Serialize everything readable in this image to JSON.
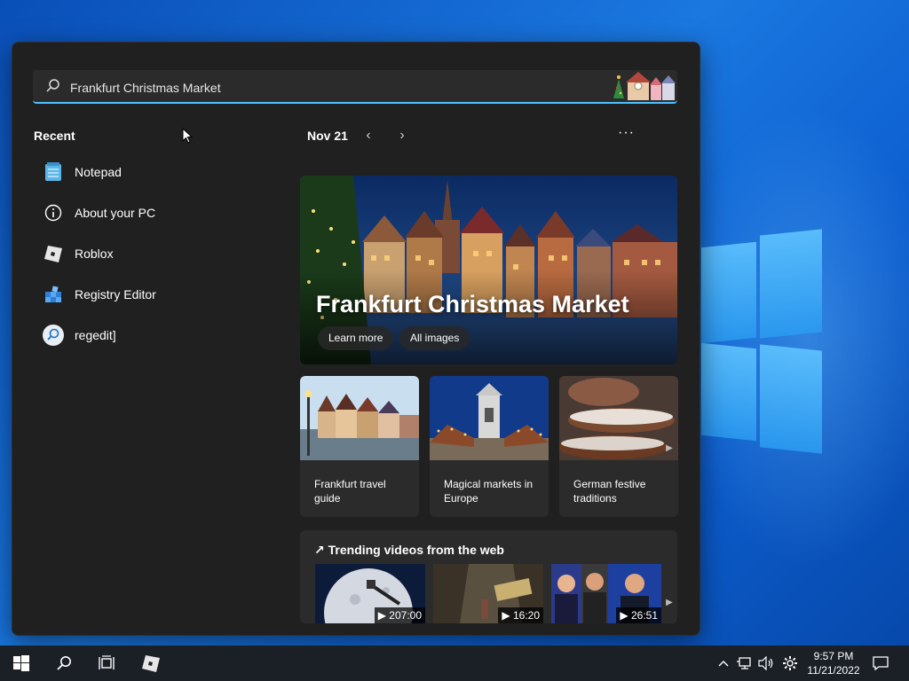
{
  "search": {
    "value": "Frankfurt Christmas Market",
    "placeholder": ""
  },
  "recent": {
    "title": "Recent",
    "items": [
      {
        "label": "Notepad",
        "icon": "notepad-icon"
      },
      {
        "label": "About your PC",
        "icon": "info-icon"
      },
      {
        "label": "Roblox",
        "icon": "roblox-icon"
      },
      {
        "label": "Registry Editor",
        "icon": "registry-editor-icon"
      },
      {
        "label": "regedit]",
        "icon": "search-result-icon"
      }
    ]
  },
  "feed": {
    "date": "Nov 21",
    "prev_icon": "‹",
    "next_icon": "›",
    "more_icon": "···"
  },
  "hero": {
    "title": "Frankfurt Christmas Market",
    "learn_more": "Learn more",
    "all_images": "All images"
  },
  "cards": [
    {
      "label": "Frankfurt travel guide"
    },
    {
      "label": "Magical markets in Europe"
    },
    {
      "label": "German festive traditions"
    }
  ],
  "trending": {
    "title": "Trending videos from the web",
    "videos": [
      {
        "duration": "207:00"
      },
      {
        "duration": "16:20"
      },
      {
        "duration": "26:51"
      }
    ]
  },
  "taskbar": {
    "time": "9:57 PM",
    "date": "11/21/2022"
  },
  "colors": {
    "accent": "#4cc2ff",
    "panel_bg": "#202020",
    "card_bg": "#2b2b2b",
    "taskbar_bg": "#1b1f26"
  }
}
